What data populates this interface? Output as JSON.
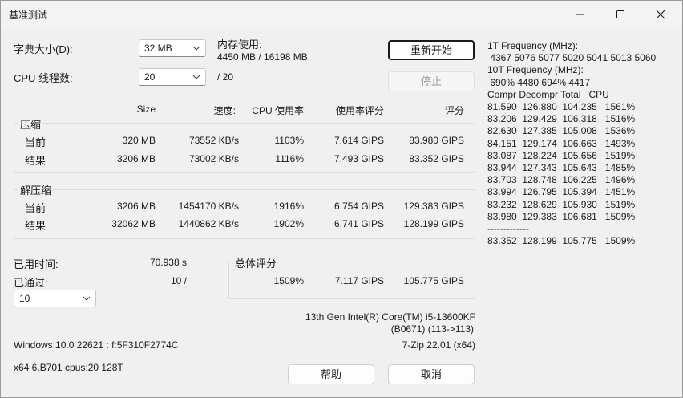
{
  "window": {
    "title": "基准测试"
  },
  "dict_size": {
    "label": "字典大小(D):",
    "value": "32 MB"
  },
  "threads": {
    "label": "CPU 线程数:",
    "value": "20",
    "of": "/ 20"
  },
  "memory": {
    "label": "内存使用:",
    "value": "4450 MB / 16198 MB"
  },
  "buttons": {
    "restart": "重新开始",
    "stop": "停止",
    "help": "帮助",
    "cancel": "取消"
  },
  "headers": {
    "size": "Size",
    "speed": "速度:",
    "cpu": "CPU 使用率",
    "rating_usage": "使用率评分",
    "rating": "评分"
  },
  "compress": {
    "title": "压缩",
    "rows": [
      {
        "label": "当前",
        "size": "320 MB",
        "speed": "73552 KB/s",
        "cpu": "1103%",
        "usage": "7.614 GIPS",
        "rating": "83.980 GIPS"
      },
      {
        "label": "结果",
        "size": "3206 MB",
        "speed": "73002 KB/s",
        "cpu": "1116%",
        "usage": "7.493 GIPS",
        "rating": "83.352 GIPS"
      }
    ]
  },
  "decompress": {
    "title": "解压缩",
    "rows": [
      {
        "label": "当前",
        "size": "3206 MB",
        "speed": "1454170 KB/s",
        "cpu": "1916%",
        "usage": "6.754 GIPS",
        "rating": "129.383 GIPS"
      },
      {
        "label": "结果",
        "size": "32062 MB",
        "speed": "1440862 KB/s",
        "cpu": "1902%",
        "usage": "6.741 GIPS",
        "rating": "128.199 GIPS"
      }
    ]
  },
  "elapsed": {
    "label": "已用时间:",
    "value": "70.938 s"
  },
  "passed": {
    "label": "已通过:",
    "value": "10 /"
  },
  "passes_combo": {
    "value": "10"
  },
  "total": {
    "title": "总体评分",
    "cpu": "1509%",
    "usage": "7.117 GIPS",
    "rating": "105.775 GIPS"
  },
  "cpu_info": {
    "line1": "13th Gen Intel(R) Core(TM) i5-13600KF",
    "line2": "(B0671) (113->113)"
  },
  "os_info": "Windows 10.0 22621 : f:5F310F2774C",
  "version": "7-Zip 22.01 (x64)",
  "arch": "x64 6.B701 cpus:20 128T",
  "log_lines": [
    "1T Frequency (MHz):",
    " 4367 5076 5077 5020 5041 5013 5060",
    "10T Frequency (MHz):",
    " 690% 4480 694% 4417",
    "Compr Decompr Total   CPU",
    "81.590  126.880  104.235   1561%",
    "83.206  129.429  106.318   1516%",
    "82.630  127.385  105.008   1536%",
    "84.151  129.174  106.663   1493%",
    "83.087  128.224  105.656   1519%",
    "83.944  127.343  105.643   1485%",
    "83.703  128.748  106.225   1496%",
    "83.994  126.795  105.394   1451%",
    "83.232  128.629  105.930   1519%",
    "83.980  129.383  106.681   1509%",
    "-------------",
    "83.352  128.199  105.775   1509%"
  ]
}
